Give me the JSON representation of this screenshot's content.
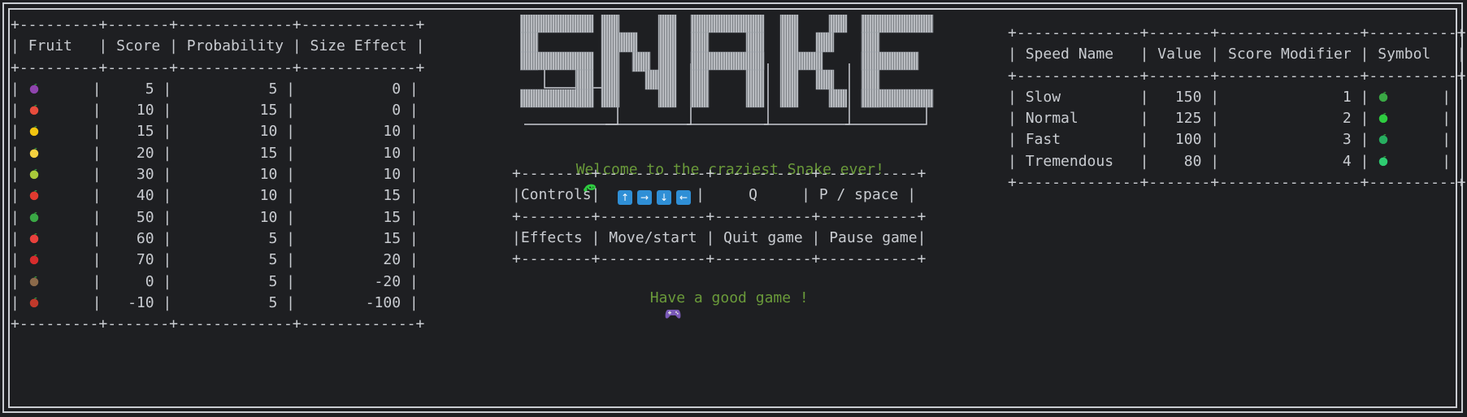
{
  "fruit_table": {
    "headers": [
      "Fruit",
      "Score",
      "Probability",
      "Size Effect"
    ],
    "rows": [
      {
        "icon": "grape-icon",
        "color": "#8e44ad",
        "score": "5",
        "probability": "5",
        "size_effect": "0"
      },
      {
        "icon": "watermelon-icon",
        "color": "#e74c3c",
        "score": "10",
        "probability": "15",
        "size_effect": "0"
      },
      {
        "icon": "lemon-icon",
        "color": "#f1c40f",
        "score": "15",
        "probability": "10",
        "size_effect": "10"
      },
      {
        "icon": "banana-icon",
        "color": "#f4d03f",
        "score": "20",
        "probability": "15",
        "size_effect": "10"
      },
      {
        "icon": "pear-icon",
        "color": "#a9c93a",
        "score": "30",
        "probability": "10",
        "size_effect": "10"
      },
      {
        "icon": "apple-icon",
        "color": "#e03b2f",
        "score": "40",
        "probability": "10",
        "size_effect": "15"
      },
      {
        "icon": "kiwi-icon",
        "color": "#3aa845",
        "score": "50",
        "probability": "10",
        "size_effect": "15"
      },
      {
        "icon": "strawberry-icon",
        "color": "#e8413c",
        "score": "60",
        "probability": "5",
        "size_effect": "15"
      },
      {
        "icon": "cherries-icon",
        "color": "#d62c2c",
        "score": "70",
        "probability": "5",
        "size_effect": "20"
      },
      {
        "icon": "coconut-icon",
        "color": "#8b6a4a",
        "score": "0",
        "probability": "5",
        "size_effect": "-20"
      },
      {
        "icon": "lobster-icon",
        "color": "#c0392b",
        "score": "-10",
        "probability": "5",
        "size_effect": "-100"
      }
    ]
  },
  "logo": {
    "text": "SNAKE"
  },
  "welcome": {
    "text": "Welcome to the craziest Snake ever!",
    "icon": "snake-icon",
    "color": "#6a9a3a"
  },
  "controls_table": {
    "rows": [
      {
        "label": "Controls",
        "col1_keys": [
          "up-arrow-key",
          "right-arrow-key",
          "down-arrow-key",
          "left-arrow-key"
        ],
        "col2": "Q",
        "col3": "P / space"
      },
      {
        "label": "Effects",
        "col1": "Move/start",
        "col2": "Quit game",
        "col3": "Pause game"
      }
    ]
  },
  "goodgame": {
    "text": "Have a good game !",
    "icon": "game-controller-icon"
  },
  "speed_table": {
    "headers": [
      "Speed Name",
      "Value",
      "Score Modifier",
      "Symbol"
    ],
    "rows": [
      {
        "name": "Slow",
        "value": "150",
        "modifier": "1",
        "symbol": "turtle-icon"
      },
      {
        "name": "Normal",
        "value": "125",
        "modifier": "2",
        "symbol": "snake-icon"
      },
      {
        "name": "Fast",
        "value": "100",
        "modifier": "3",
        "symbol": "dragon-icon"
      },
      {
        "name": "Tremendous",
        "value": "80",
        "modifier": "4",
        "symbol": "t-rex-icon"
      }
    ]
  },
  "colors": {
    "background": "#1e1f22",
    "text": "#c9ccd1",
    "accent_green": "#6a9a3a",
    "key_blue": "#2f8fd6"
  }
}
